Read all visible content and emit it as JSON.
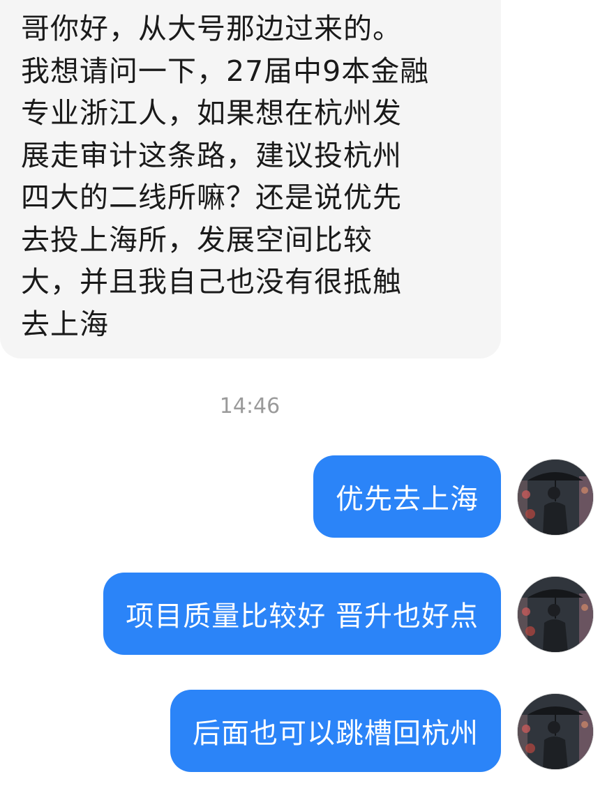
{
  "incoming_message": {
    "text": "哥你好，从大号那边过来的。\n我想请问一下，27届中9本金融\n专业浙江人，如果想在杭州发\n展走审计这条路，建议投杭州\n四大的二线所嘛？还是说优先\n去投上海所，发展空间比较\n大，并且我自己也没有很抵触\n去上海"
  },
  "timestamp": "14:46",
  "outgoing_messages": [
    {
      "text": "优先去上海"
    },
    {
      "text": "项目质量比较好 晋升也好点"
    },
    {
      "text": "后面也可以跳槽回杭州"
    }
  ],
  "colors": {
    "outgoing_bubble": "#2b84f8",
    "incoming_bubble": "#f5f5f5",
    "timestamp": "#9a9a9a"
  },
  "icons": {
    "avatar": "avatar-man-with-umbrella-icon"
  }
}
